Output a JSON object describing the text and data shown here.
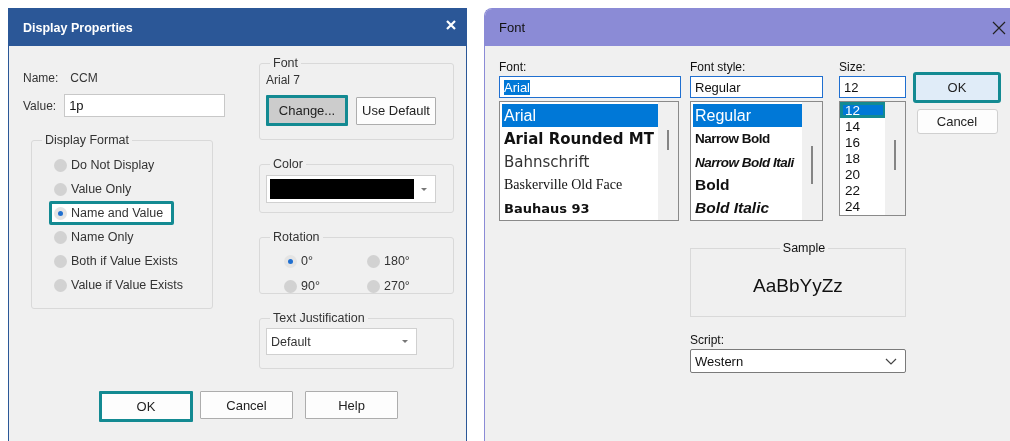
{
  "display_properties": {
    "title": "Display Properties",
    "name_label": "Name:",
    "name_value": "CCM",
    "value_label": "Value:",
    "value": "1p",
    "display_format": {
      "title": "Display Format",
      "options": [
        {
          "label": "Do Not Display",
          "selected": false,
          "highlighted": false
        },
        {
          "label": "Value Only",
          "selected": false,
          "highlighted": false
        },
        {
          "label": "Name and Value",
          "selected": true,
          "highlighted": true
        },
        {
          "label": "Name Only",
          "selected": false,
          "highlighted": false
        },
        {
          "label": "Both if Value Exists",
          "selected": false,
          "highlighted": false
        },
        {
          "label": "Value if Value Exists",
          "selected": false,
          "highlighted": false
        }
      ]
    },
    "font": {
      "title": "Font",
      "current": "Arial 7",
      "buttons": [
        {
          "label": "Change...",
          "highlighted": true,
          "pressed": true
        },
        {
          "label": "Use Default",
          "highlighted": false,
          "pressed": false
        }
      ]
    },
    "color": {
      "title": "Color",
      "color": "#000000"
    },
    "rotation": {
      "title": "Rotation",
      "options": [
        {
          "label": "0°",
          "selected": true
        },
        {
          "label": "180°",
          "selected": false
        },
        {
          "label": "90°",
          "selected": false
        },
        {
          "label": "270°",
          "selected": false
        }
      ]
    },
    "text_justification": {
      "title": "Text Justification",
      "value": "Default"
    },
    "buttons": [
      {
        "label": "OK",
        "highlighted": true
      },
      {
        "label": "Cancel",
        "highlighted": false
      },
      {
        "label": "Help",
        "highlighted": false
      }
    ]
  },
  "font_dialog": {
    "title": "Font",
    "font": {
      "label": "Font:",
      "value": "Arial",
      "text_selected": true,
      "items": [
        {
          "label": "Arial",
          "kind": "sans",
          "selected": true
        },
        {
          "label": "Arial Rounded MT",
          "kind": "rounded",
          "selected": false
        },
        {
          "label": "Bahnschrift",
          "kind": "light",
          "selected": false
        },
        {
          "label": "Baskerville Old Face",
          "kind": "serif",
          "selected": false
        },
        {
          "label": "Bauhaus 93",
          "kind": "display",
          "selected": false
        }
      ]
    },
    "style": {
      "label": "Font style:",
      "value": "Regular",
      "items": [
        {
          "label": "Regular",
          "kind": "regular",
          "selected": true
        },
        {
          "label": "Narrow Bold",
          "kind": "narrowbold",
          "selected": false
        },
        {
          "label": "Narrow Bold Itali",
          "kind": "narrowbolditalic",
          "selected": false
        },
        {
          "label": "Bold",
          "kind": "bold",
          "selected": false
        },
        {
          "label": "Bold Italic",
          "kind": "bolditalic",
          "selected": false
        }
      ]
    },
    "size": {
      "label": "Size:",
      "value": "12",
      "items": [
        {
          "label": "12",
          "selected": true,
          "highlighted": true
        },
        {
          "label": "14",
          "selected": false,
          "highlighted": false
        },
        {
          "label": "16",
          "selected": false,
          "highlighted": false
        },
        {
          "label": "18",
          "selected": false,
          "highlighted": false
        },
        {
          "label": "20",
          "selected": false,
          "highlighted": false
        },
        {
          "label": "22",
          "selected": false,
          "highlighted": false
        },
        {
          "label": "24",
          "selected": false,
          "highlighted": false
        }
      ]
    },
    "buttons": [
      {
        "label": "OK",
        "highlighted": true
      },
      {
        "label": "Cancel",
        "highlighted": false
      }
    ],
    "sample": {
      "title": "Sample",
      "text": "AaBbYyZz"
    },
    "script": {
      "label": "Script:",
      "value": "Western"
    }
  }
}
